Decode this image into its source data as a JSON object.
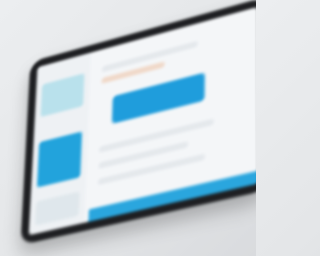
{
  "scene": {
    "description_type": "blurred photo of a tablet displaying an app UI",
    "colors": {
      "background": "#e6e8ea",
      "device_bezel": "#1e1f22",
      "screen": "#f4f6f8",
      "accent_blue": "#1f9ddc",
      "light_blue": "#b9e1ec"
    }
  }
}
